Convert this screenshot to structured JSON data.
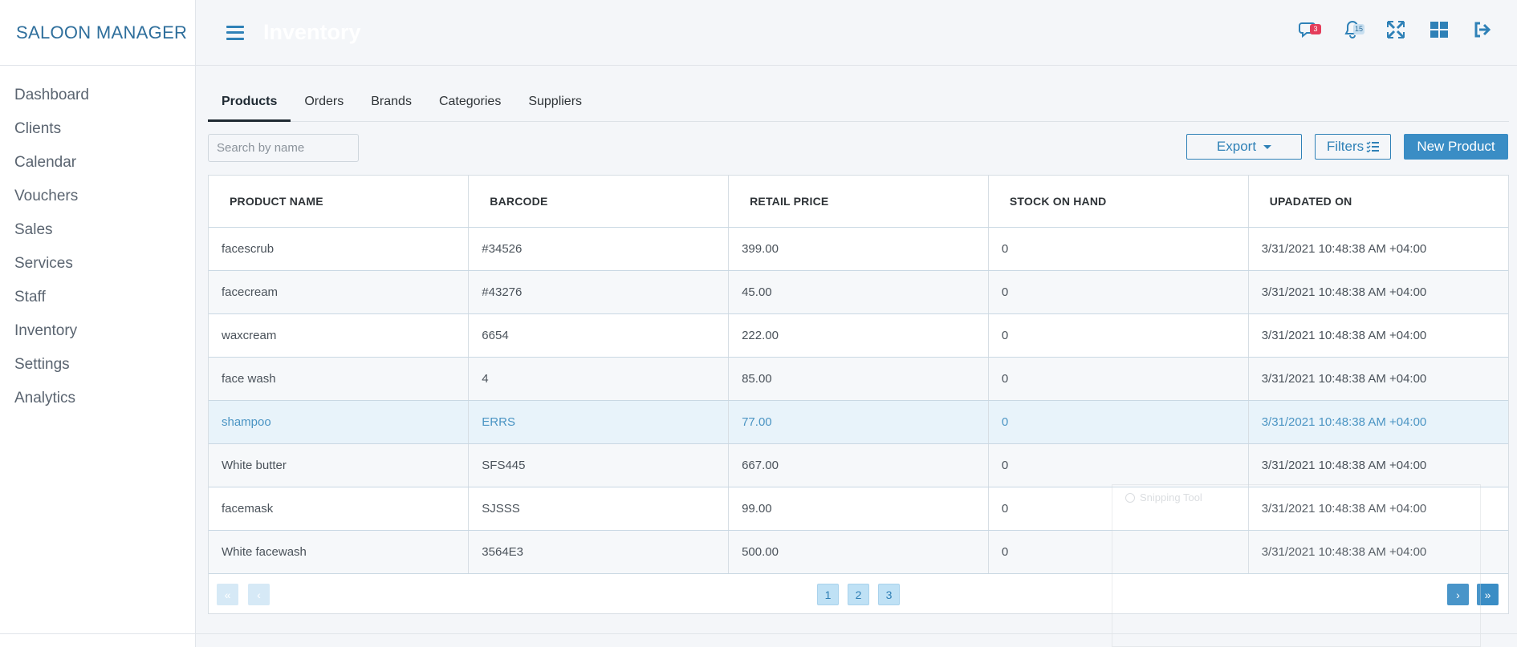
{
  "app": {
    "brand": "SALOON MANAGER"
  },
  "sidebar": {
    "items": [
      {
        "label": "Dashboard"
      },
      {
        "label": "Clients"
      },
      {
        "label": "Calendar"
      },
      {
        "label": "Vouchers"
      },
      {
        "label": "Sales"
      },
      {
        "label": "Services"
      },
      {
        "label": "Staff"
      },
      {
        "label": "Inventory"
      },
      {
        "label": "Settings"
      },
      {
        "label": "Analytics"
      }
    ]
  },
  "header": {
    "title": "Inventory",
    "icons": [
      {
        "name": "chat-icon",
        "badge": "3"
      },
      {
        "name": "bell-icon",
        "badge": "15"
      },
      {
        "name": "fullscreen-icon"
      },
      {
        "name": "grid-icon"
      },
      {
        "name": "logout-icon"
      }
    ]
  },
  "tabs": [
    {
      "label": "Products",
      "active": true
    },
    {
      "label": "Orders"
    },
    {
      "label": "Brands"
    },
    {
      "label": "Categories"
    },
    {
      "label": "Suppliers"
    }
  ],
  "toolbar": {
    "search_placeholder": "Search by name",
    "export_label": "Export",
    "filters_label": "Filters",
    "new_label": "New Product"
  },
  "table": {
    "columns": [
      "PRODUCT NAME",
      "BARCODE",
      "RETAIL PRICE",
      "STOCK ON HAND",
      "UPADATED ON"
    ],
    "rows": [
      [
        "facescrub",
        "#34526",
        "399.00",
        "0",
        "3/31/2021 10:48:38 AM +04:00"
      ],
      [
        "facecream",
        "#43276",
        "45.00",
        "0",
        "3/31/2021 10:48:38 AM +04:00"
      ],
      [
        "waxcream",
        "6654",
        "222.00",
        "0",
        "3/31/2021 10:48:38 AM +04:00"
      ],
      [
        "face wash",
        "4",
        "85.00",
        "0",
        "3/31/2021 10:48:38 AM +04:00"
      ],
      [
        "shampoo",
        "ERRS",
        "77.00",
        "0",
        "3/31/2021 10:48:38 AM +04:00"
      ],
      [
        "White butter",
        "SFS445",
        "667.00",
        "0",
        "3/31/2021 10:48:38 AM +04:00"
      ],
      [
        "facemask",
        "SJSSS",
        "99.00",
        "0",
        "3/31/2021 10:48:38 AM +04:00"
      ],
      [
        "White facewash",
        "3564E3",
        "500.00",
        "0",
        "3/31/2021 10:48:38 AM +04:00"
      ]
    ],
    "highlighted_row": 4
  },
  "pagination": {
    "first": "«",
    "prev": "‹",
    "pages": [
      "1",
      "2",
      "3"
    ],
    "next": "›",
    "last": "»"
  },
  "overlay": {
    "title": "Snipping Tool"
  },
  "colors": {
    "accent": "#3a8dc5",
    "brand": "#2f6f9c",
    "badge_red": "#e43d5b"
  }
}
